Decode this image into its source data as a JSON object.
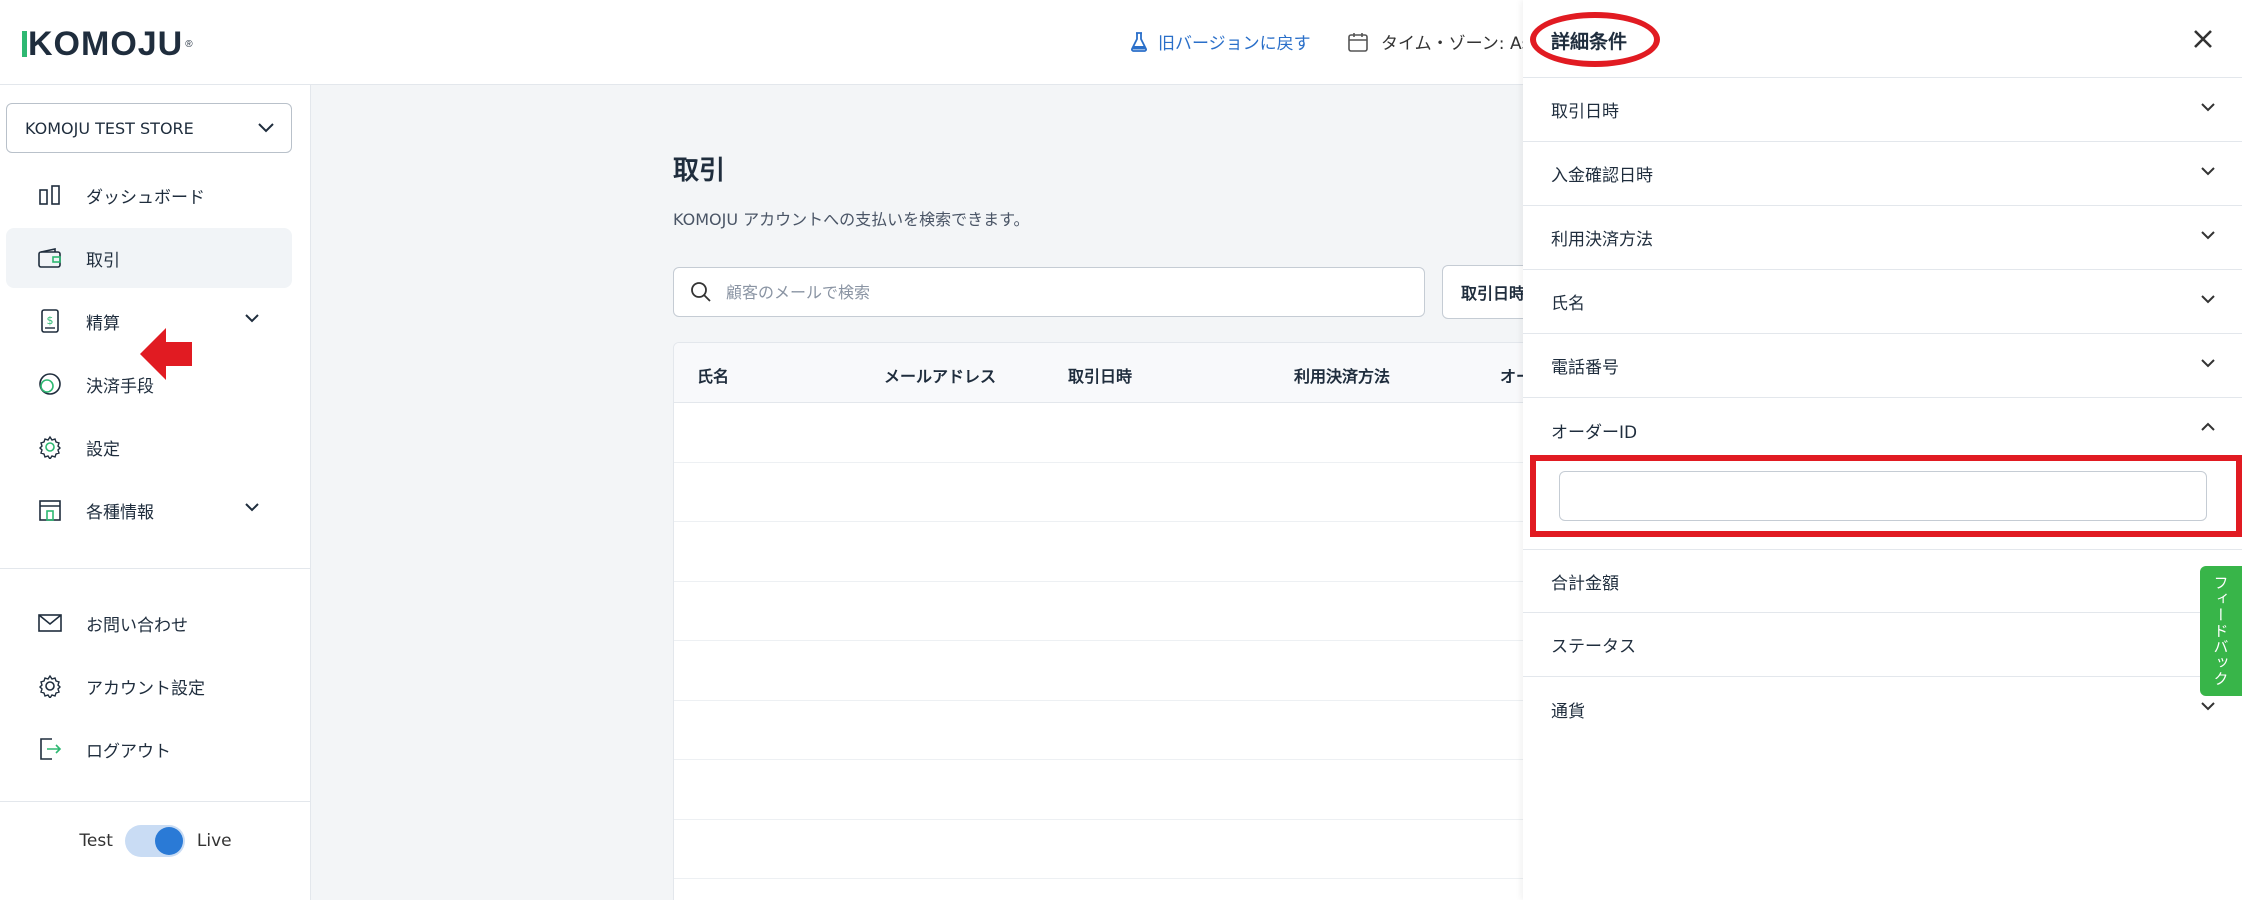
{
  "header": {
    "logo": "KOMOJU",
    "legacy_link": "旧バージョンに戻す",
    "timezone_label": "タイム・ゾーン: Asi"
  },
  "sidebar": {
    "store": "KOMOJU TEST STORE",
    "nav": [
      {
        "label": "ダッシュボード",
        "icon": "dashboard-icon"
      },
      {
        "label": "取引",
        "icon": "wallet-icon"
      },
      {
        "label": "精算",
        "icon": "settlement-icon"
      },
      {
        "label": "決済手段",
        "icon": "payment-method-icon"
      },
      {
        "label": "設定",
        "icon": "gear-icon"
      },
      {
        "label": "各種情報",
        "icon": "info-icon"
      }
    ],
    "secondary": [
      {
        "label": "お問い合わせ",
        "icon": "mail-icon"
      },
      {
        "label": "アカウント設定",
        "icon": "gear-icon"
      },
      {
        "label": "ログアウト",
        "icon": "logout-icon"
      }
    ],
    "toggle": {
      "left": "Test",
      "right": "Live",
      "state": "Live"
    }
  },
  "main": {
    "title": "取引",
    "subtitle": "KOMOJU アカウントへの支払いを検索できます。",
    "search_placeholder": "顧客のメールで検索",
    "date_button": "取引日時",
    "table_headers": [
      "氏名",
      "メールアドレス",
      "取引日時",
      "利用決済方法",
      "オー"
    ]
  },
  "drawer": {
    "title": "詳細条件",
    "filters": [
      {
        "label": "取引日時",
        "expanded": false
      },
      {
        "label": "入金確認日時",
        "expanded": false
      },
      {
        "label": "利用決済方法",
        "expanded": false
      },
      {
        "label": "氏名",
        "expanded": false
      },
      {
        "label": "電話番号",
        "expanded": false
      },
      {
        "label": "オーダーID",
        "expanded": true
      },
      {
        "label": "合計金額",
        "expanded": false
      },
      {
        "label": "ステータス",
        "expanded": false
      },
      {
        "label": "通貨",
        "expanded": false
      }
    ],
    "order_id_value": ""
  },
  "feedback_tab": "フィードバック",
  "colors": {
    "accent": "#2a7ad6",
    "annotation": "#e11b22",
    "feedback": "#38b549",
    "logo_bar": "#2eb872"
  }
}
